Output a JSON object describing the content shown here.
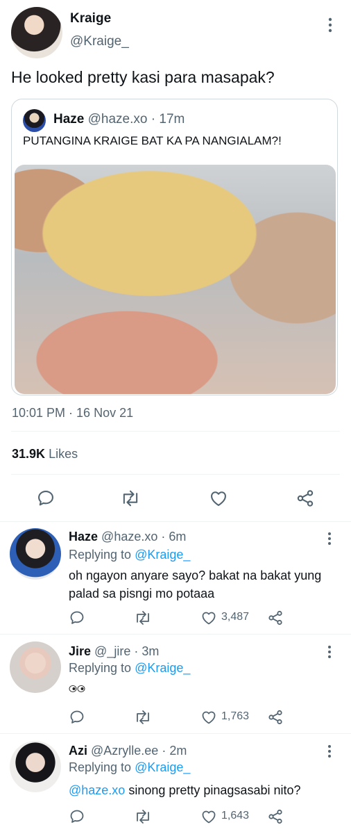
{
  "tweet": {
    "author": {
      "name": "Kraige",
      "handle": "@Kraige_"
    },
    "text": "He looked pretty kasi para masapak?",
    "quote": {
      "name": "Haze",
      "handle": "@haze.xo",
      "time": "17m",
      "separator": "·",
      "text": "PUTANGINA KRAIGE BAT KA PA NANGIALAM?!"
    },
    "timestamp": "10:01 PM · 16 Nov 21",
    "likes_count": "31.9K",
    "likes_label": "Likes",
    "actions": [
      "reply-icon",
      "retweet-icon",
      "like-icon",
      "share-icon"
    ]
  },
  "replies": [
    {
      "name": "Haze",
      "handle": "@haze.xo",
      "separator": "·",
      "time": "6m",
      "replying_label": "Replying to",
      "replying_to": "@Kraige_",
      "text": "oh ngayon anyare sayo? bakat na bakat yung palad sa pisngi mo potaaa",
      "mention": "",
      "likes": "3,487"
    },
    {
      "name": "Jire",
      "handle": "@_jire",
      "separator": "·",
      "time": "3m",
      "replying_label": "Replying to",
      "replying_to": "@Kraige_",
      "text": "",
      "emoji": "eyes-emoji",
      "likes": "1,763"
    },
    {
      "name": "Azi",
      "handle": "@Azrylle.ee",
      "separator": "·",
      "time": "2m",
      "replying_label": "Replying to",
      "replying_to": "@Kraige_",
      "mention": "@haze.xo",
      "text": " sinong pretty pinagsasabi nito?",
      "likes": "1,643"
    }
  ],
  "colors": {
    "link": "#1d9bf0",
    "muted": "#536471",
    "text": "#0f1419",
    "divider": "#eff3f4"
  }
}
